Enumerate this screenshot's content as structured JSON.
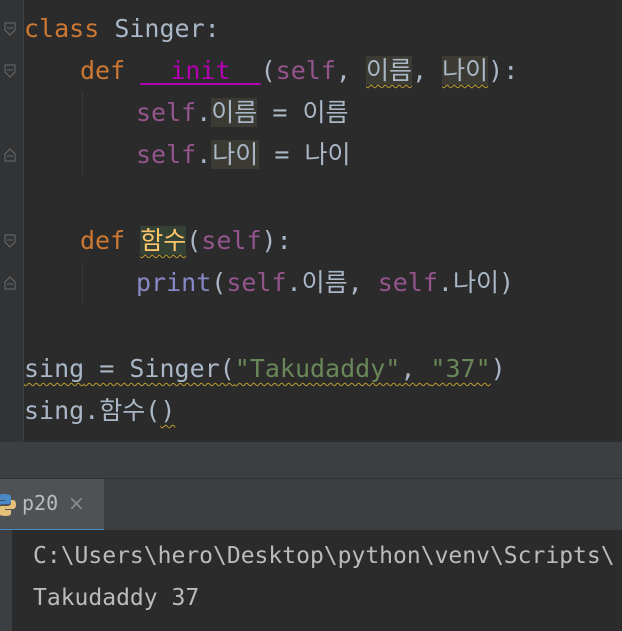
{
  "editor": {
    "line1": {
      "kw": "class",
      "name": " Singer:"
    },
    "line2": {
      "kw": "def",
      "fn": "__init__",
      "open": "(",
      "self": "self",
      "comma1": ", ",
      "p1": "이름",
      "comma2": ", ",
      "p2": "나이",
      "close": "):"
    },
    "line3": {
      "self": "self",
      "dot": ".",
      "attr": "이름",
      "rest": " = 이름"
    },
    "line4": {
      "self": "self",
      "dot": ".",
      "attr": "나이",
      "rest": " = 나이"
    },
    "line6": {
      "kw": "def",
      "fn": "함수",
      "open": "(",
      "self": "self",
      "close": "):"
    },
    "line7": {
      "bi": "print",
      "open": "(",
      "self1": "self",
      "mid1": ".이름, ",
      "self2": "self",
      "mid2": ".나이)"
    },
    "line9": {
      "var": "sing",
      "eq": " = Singer(",
      "s1": "\"Takudaddy\"",
      "comma": ", ",
      "s2": "\"37\"",
      "close": ")"
    },
    "line10": {
      "pre": "sing.함수(",
      "close": ")"
    }
  },
  "run_panel": {
    "tab_label": "p20",
    "close_glyph": "×"
  },
  "console": {
    "lines": [
      "C:\\Users\\hero\\Desktop\\python\\venv\\Scripts\\",
      "Takudaddy 37"
    ]
  },
  "colors": {
    "background": "#2b2b2b",
    "keyword": "#cc7832",
    "self": "#94558d",
    "string": "#6a8759",
    "builtin": "#8888c6",
    "default": "#a9b7c6"
  }
}
